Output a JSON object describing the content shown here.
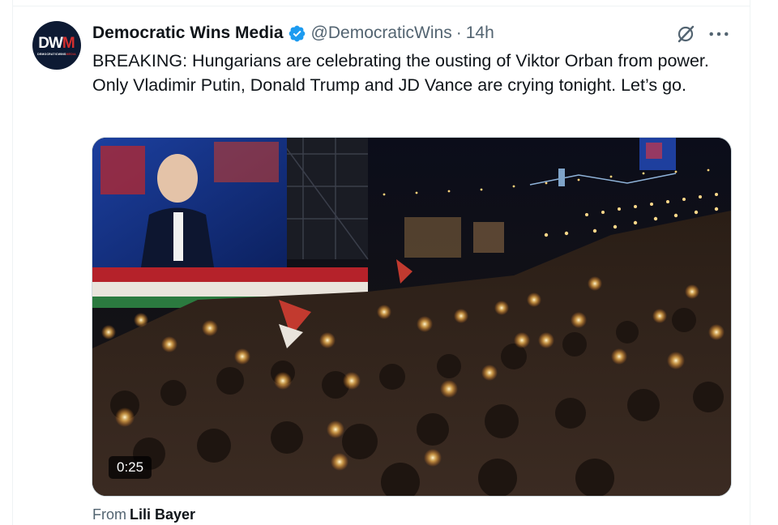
{
  "post": {
    "author": {
      "display_name": "Democratic Wins Media",
      "handle": "@DemocraticWins",
      "verified": true,
      "avatar": {
        "logo_dw": "DW",
        "logo_m": "M",
        "logo_sub": "DEMOCRATICWINS",
        "logo_sub_red": "MEDIA"
      }
    },
    "separator": "·",
    "time": "14h",
    "text": "BREAKING: Hungarians are celebrating the ousting of Viktor Orban from power. Only Vladimir Putin, Donald Trump and JD Vance are crying tonight. Let’s go.",
    "media": {
      "type": "video",
      "duration": "0:25"
    },
    "attribution": {
      "prefix": "From",
      "name": "Lili Bayer"
    },
    "icons": {
      "verified": "verified-badge-icon",
      "grok": "grok-icon",
      "more": "more-options-icon"
    }
  },
  "colors": {
    "verified_blue": "#1d9bf0",
    "secondary_text": "#536471",
    "primary_text": "#0f1419",
    "border": "#cfd9de"
  }
}
